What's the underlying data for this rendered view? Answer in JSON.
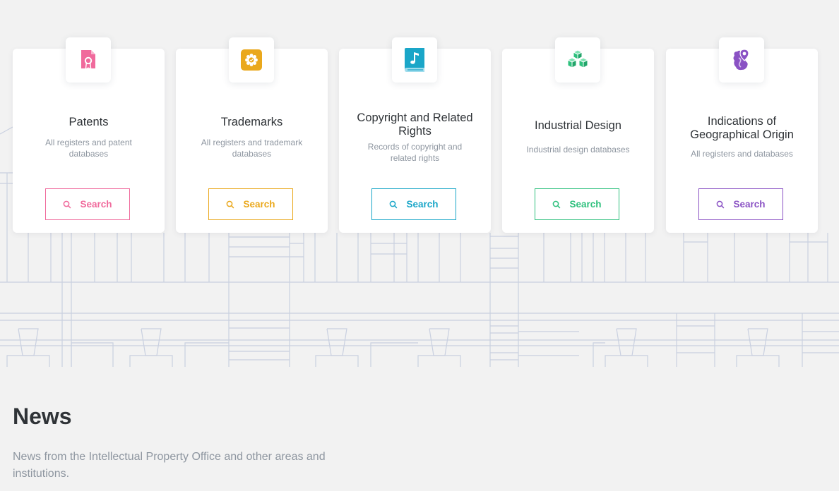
{
  "cards": [
    {
      "title": "Patents",
      "description": "All registers and patent databases",
      "button_label": "Search",
      "icon": "patent-certificate-icon",
      "color": "#f06a9c"
    },
    {
      "title": "Trademarks",
      "description": "All registers and trademark databases",
      "button_label": "Search",
      "icon": "trademark-seal-icon",
      "color": "#eaa81c"
    },
    {
      "title": "Copyright and Related Rights",
      "description": "Records of copyright and related rights",
      "button_label": "Search",
      "icon": "music-book-icon",
      "color": "#1aa6c8"
    },
    {
      "title": "Industrial Design",
      "description": "Industrial design databases",
      "button_label": "Search",
      "icon": "cubes-icon",
      "color": "#2ec07d"
    },
    {
      "title": "Indications of Geographical Origin",
      "description": "All registers and databases",
      "button_label": "Search",
      "icon": "map-pin-icon",
      "color": "#8a52c4"
    }
  ],
  "news": {
    "title": "News",
    "description": "News from the Intellectual Property Office and other areas and institutions."
  }
}
